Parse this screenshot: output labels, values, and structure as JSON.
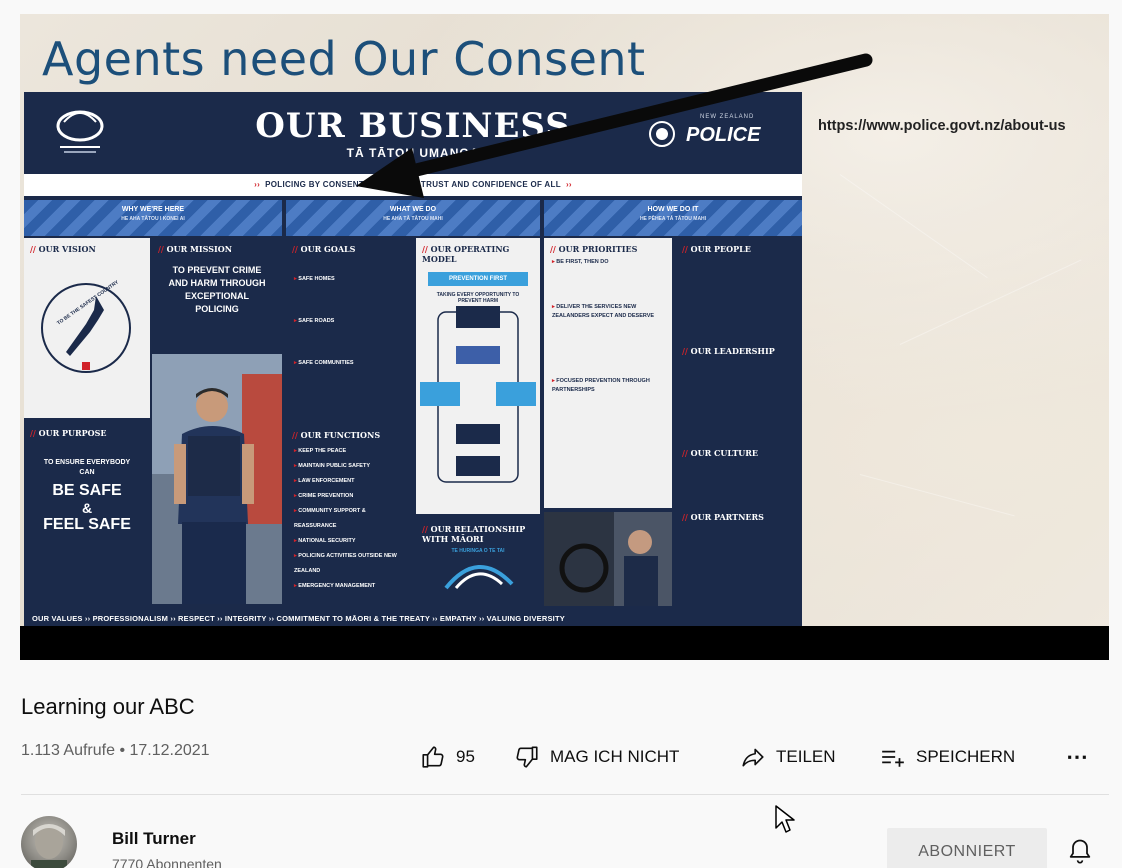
{
  "slide": {
    "title": "Agents need Our Consent",
    "url": "https://www.police.govt.nz/about-us",
    "poster": {
      "title": "OUR BUSINESS",
      "subtitle": "TĀ TĀTOU UMANGA",
      "police_label": "POLICE",
      "police_nz": "NEW ZEALAND",
      "consent_line": "POLICING BY CONSENT — WITH THE TRUST AND CONFIDENCE OF ALL",
      "columns": [
        {
          "title": "WHY WE'RE HERE",
          "sub": "HE AHA TĀTOU I KONEI AI"
        },
        {
          "title": "WHAT WE DO",
          "sub": "HE AHA TĀ TĀTOU MAHI"
        },
        {
          "title": "HOW WE DO IT",
          "sub": "HE PĒHEA TĀ TĀTOU MAHI"
        }
      ],
      "vision": {
        "heading": "OUR VISION",
        "text": "TO BE THE SAFEST COUNTRY"
      },
      "mission": {
        "heading": "OUR MISSION",
        "text": "TO PREVENT CRIME AND HARM THROUGH EXCEPTIONAL POLICING"
      },
      "purpose": {
        "heading": "OUR PURPOSE",
        "line1": "TO ENSURE EVERYBODY CAN",
        "line2": "BE SAFE",
        "line3": "&",
        "line4": "FEEL SAFE"
      },
      "goals": {
        "heading": "OUR GOALS",
        "items": [
          "SAFE HOMES",
          "SAFE ROADS",
          "SAFE COMMUNITIES"
        ]
      },
      "operating": {
        "heading": "OUR OPERATING MODEL",
        "box": "PREVENTION FIRST",
        "note": "TAKING EVERY OPPORTUNITY TO PREVENT HARM"
      },
      "functions": {
        "heading": "OUR FUNCTIONS",
        "items": [
          "KEEP THE PEACE",
          "MAINTAIN PUBLIC SAFETY",
          "LAW ENFORCEMENT",
          "CRIME PREVENTION",
          "COMMUNITY SUPPORT & REASSURANCE",
          "NATIONAL SECURITY",
          "POLICING ACTIVITIES OUTSIDE NEW ZEALAND",
          "EMERGENCY MANAGEMENT"
        ]
      },
      "relationship": {
        "heading": "OUR RELATIONSHIP WITH MĀORI",
        "sub": "TE HURINGA O TE TAI"
      },
      "priorities": {
        "heading": "OUR PRIORITIES",
        "items": [
          "BE FIRST, THEN DO",
          "DELIVER THE SERVICES NEW ZEALANDERS EXPECT AND DESERVE",
          "FOCUSED PREVENTION THROUGH PARTNERSHIPS"
        ]
      },
      "people": {
        "heading": "OUR PEOPLE"
      },
      "leadership": {
        "heading": "OUR LEADERSHIP"
      },
      "culture": {
        "heading": "OUR CULTURE"
      },
      "partners": {
        "heading": "OUR PARTNERS"
      },
      "values_line": "OUR VALUES  ››  PROFESSIONALISM  ››  RESPECT  ››  INTEGRITY  ››  COMMITMENT TO MĀORI & THE TREATY  ››  EMPATHY  ››  VALUING DIVERSITY"
    }
  },
  "video": {
    "title": "Learning our ABC",
    "views_date": "1.113 Aufrufe • 17.12.2021",
    "likes": "95",
    "dislike_label": "MAG ICH NICHT",
    "share_label": "TEILEN",
    "save_label": "SPEICHERN",
    "more_label": "⋯"
  },
  "channel": {
    "name": "Bill Turner",
    "subscribers": "7770 Abonnenten",
    "subscribe_label": "ABONNIERT"
  },
  "colors": {
    "title_blue": "#1c4f7a",
    "poster_navy": "#1b2a4a",
    "accent_red": "#d1232a"
  }
}
